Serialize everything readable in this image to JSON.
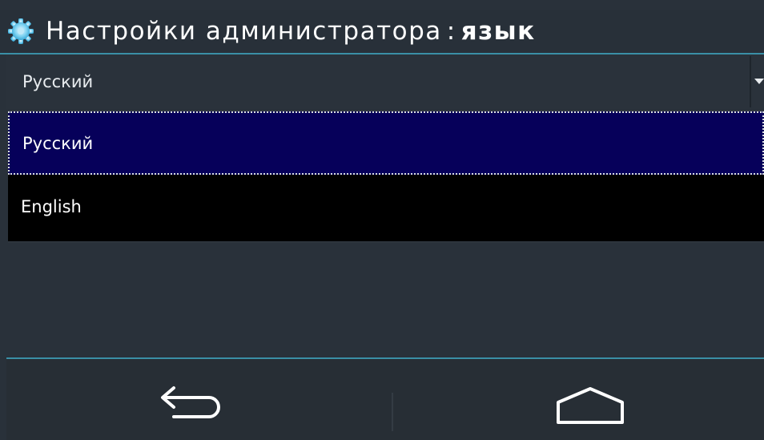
{
  "title_bar": {
    "icon": "gear-icon",
    "main": "Настройки администратора",
    "separator": ":",
    "sub": "язык"
  },
  "language_select": {
    "value": "Русский"
  },
  "dropdown": {
    "options": [
      {
        "label": "Русский",
        "selected": true
      },
      {
        "label": "English",
        "selected": false
      }
    ]
  },
  "nav": {
    "back_icon": "back-arrow-icon",
    "home_icon": "home-icon"
  },
  "colors": {
    "accent": "#3a8fa6",
    "selected_bg": "#06005a",
    "background": "#29313a"
  }
}
